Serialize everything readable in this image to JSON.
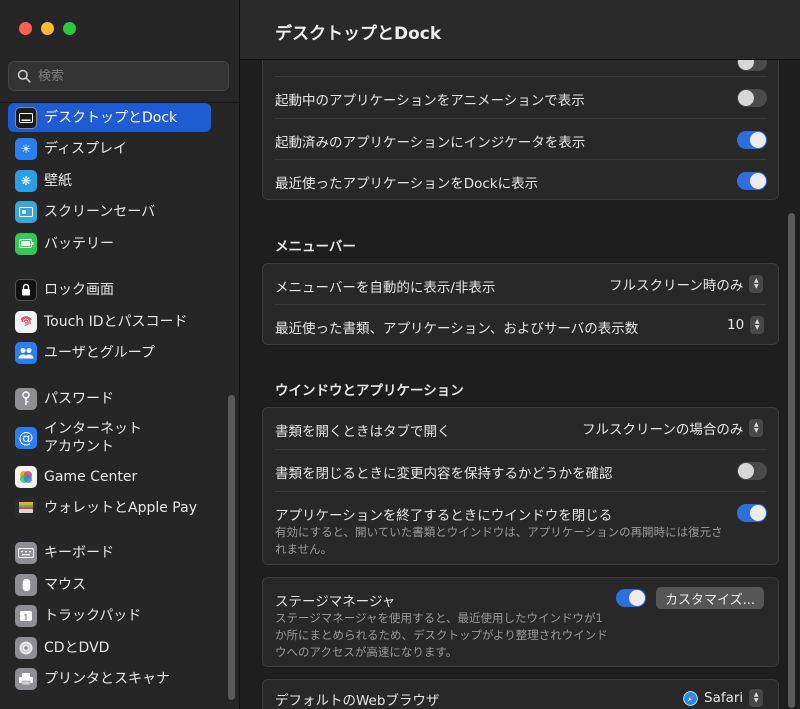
{
  "window": {
    "title": "デスクトップとDock"
  },
  "search": {
    "placeholder": "検索"
  },
  "sidebar": {
    "items": [
      {
        "label": "デスクトップとDock"
      },
      {
        "label": "ディスプレイ"
      },
      {
        "label": "壁紙"
      },
      {
        "label": "スクリーンセーバ"
      },
      {
        "label": "バッテリー"
      },
      {
        "label": "ロック画面"
      },
      {
        "label": "Touch IDとパスコード"
      },
      {
        "label": "ユーザとグループ"
      },
      {
        "label": "パスワード"
      },
      {
        "label": "インターネット",
        "label2": "アカウント"
      },
      {
        "label": "Game Center"
      },
      {
        "label": "ウォレットとApple Pay"
      },
      {
        "label": "キーボード"
      },
      {
        "label": "マウス"
      },
      {
        "label": "トラックパッド"
      },
      {
        "label": "CDとDVD"
      },
      {
        "label": "プリンタとスキャナ"
      }
    ]
  },
  "dock": {
    "rows": [
      {
        "label": "起動中のアプリケーションをアニメーションで表示",
        "on": false
      },
      {
        "label": "起動済みのアプリケーションにインジケータを表示",
        "on": true
      },
      {
        "label": "最近使ったアプリケーションをDockに表示",
        "on": true
      }
    ]
  },
  "menubar": {
    "heading": "メニューバー",
    "auto_hide_label": "メニューバーを自動的に表示/非表示",
    "auto_hide_value": "フルスクリーン時のみ",
    "recent_label": "最近使った書類、アプリケーション、およびサーバの表示数",
    "recent_value": "10"
  },
  "windows": {
    "heading": "ウインドウとアプリケーション",
    "tabs_label": "書類を開くときはタブで開く",
    "tabs_value": "フルスクリーンの場合のみ",
    "ask_label": "書類を閉じるときに変更内容を保持するかどうかを確認",
    "ask_on": false,
    "close_label": "アプリケーションを終了するときにウインドウを閉じる",
    "close_on": true,
    "close_desc_1": "有効にすると、開いていた書類とウインドウは、アプリケーションの再開時には復元さ",
    "close_desc_2": "れません。"
  },
  "stage": {
    "label": "ステージマネージャ",
    "on": true,
    "customize": "カスタマイズ...",
    "desc_1": "ステージマネージャを使用すると、最近使用したウインドウが1",
    "desc_2": "か所にまとめられるため、デスクトップがより整理されウインド",
    "desc_3": "ウへのアクセスが高速になります。"
  },
  "browser": {
    "label": "デフォルトのWebブラウザ",
    "value": "Safari"
  },
  "colors": {
    "accent": "#1f5bd3",
    "toggle_on": "#2f6fdd",
    "close": "#ff5f57",
    "minimize": "#febc2e",
    "zoom": "#28c840"
  }
}
